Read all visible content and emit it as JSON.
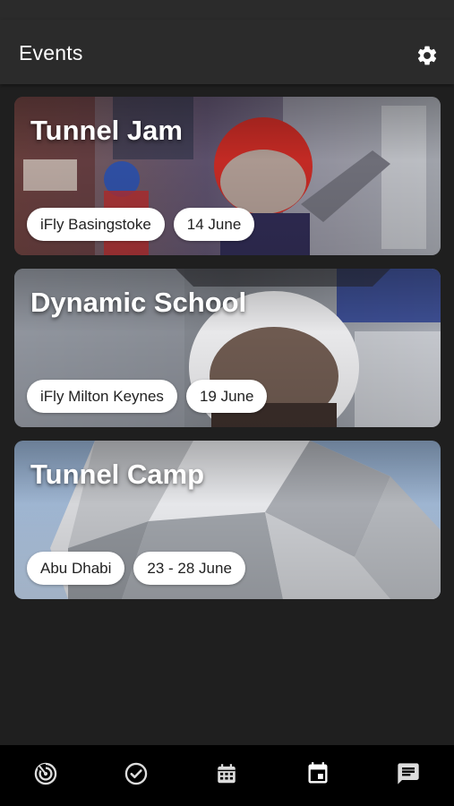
{
  "header": {
    "title": "Events",
    "settings_icon": "gear-icon"
  },
  "events": [
    {
      "title": "Tunnel Jam",
      "location": "iFly Basingstoke",
      "date": "14 June"
    },
    {
      "title": "Dynamic School",
      "location": "iFly Milton Keynes",
      "date": "19 June"
    },
    {
      "title": "Tunnel Camp",
      "location": "Abu Dhabi",
      "date": "23 - 28 June"
    }
  ],
  "bottom_nav": {
    "items": [
      {
        "icon": "radar-icon",
        "active": false
      },
      {
        "icon": "check-circle-icon",
        "active": false
      },
      {
        "icon": "calendar-icon",
        "active": false
      },
      {
        "icon": "event-calendar-icon",
        "active": true
      },
      {
        "icon": "message-icon",
        "active": false
      }
    ]
  },
  "colors": {
    "background": "#1f1f1f",
    "appbar": "#2b2b2b",
    "bottom_nav": "#000000",
    "chip": "#ffffff"
  }
}
